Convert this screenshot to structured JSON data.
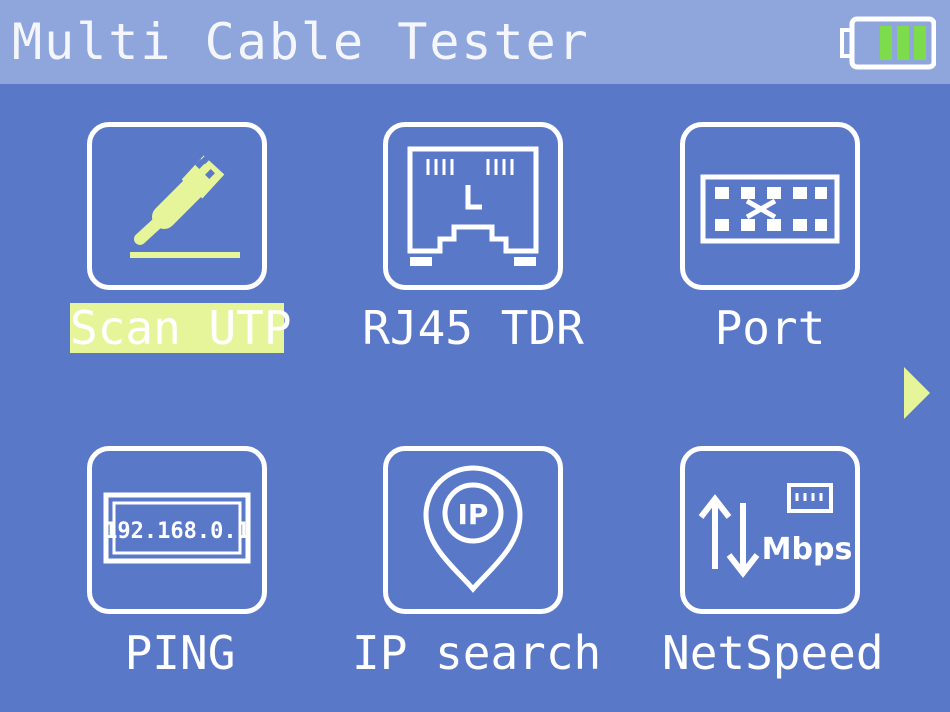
{
  "header": {
    "title": "Multi Cable Tester",
    "battery": {
      "level_bars": 3,
      "max_bars": 3,
      "fill_color": "#7ddc4c"
    }
  },
  "menu": {
    "items": [
      {
        "label": "Scan UTP",
        "icon": "cable-plug-icon",
        "selected": true
      },
      {
        "label": "RJ45 TDR",
        "icon": "rj45-port-icon",
        "selected": false
      },
      {
        "label": "Port",
        "icon": "port-grid-icon",
        "selected": false
      },
      {
        "label": "PING",
        "icon": "ip-display-icon",
        "selected": false,
        "icon_text": "192.168.0.1"
      },
      {
        "label": "IP search",
        "icon": "ip-pin-icon",
        "selected": false,
        "icon_text": "IP"
      },
      {
        "label": "NetSpeed",
        "icon": "netspeed-icon",
        "selected": false,
        "icon_text": "Mbps"
      }
    ],
    "next_page_icon": "triangle-right-icon"
  },
  "colors": {
    "background": "#5a78c8",
    "titlebar": "#8ea6dc",
    "accent": "#e6f59a",
    "foreground": "#ffffff"
  }
}
